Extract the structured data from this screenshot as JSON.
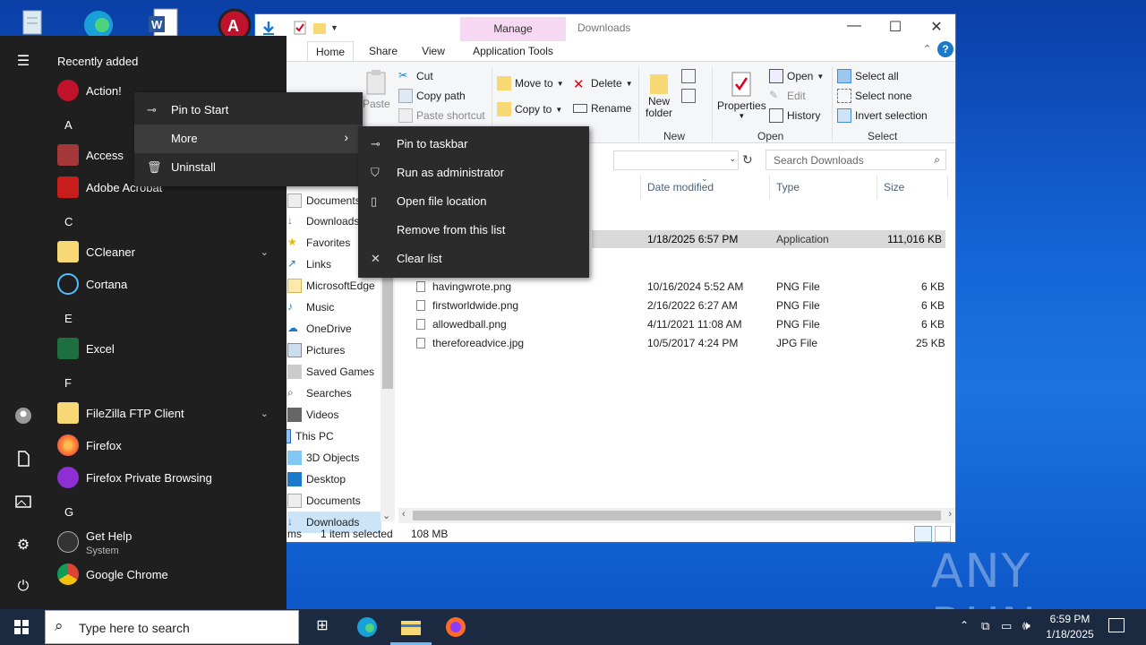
{
  "explorer": {
    "title": "Downloads",
    "manage_tab": "Manage",
    "tabs": [
      "Home",
      "Share",
      "View",
      "Application Tools"
    ],
    "ribbon": {
      "paste": "Paste",
      "cut": "Cut",
      "copy_path": "Copy path",
      "paste_shortcut": "Paste shortcut",
      "move_to": "Move to",
      "copy_to": "Copy to",
      "delete": "Delete",
      "rename": "Rename",
      "new_folder_1": "New",
      "new_folder_2": "folder",
      "new_group": "New",
      "properties": "Properties",
      "open": "Open",
      "edit": "Edit",
      "history": "History",
      "open_group": "Open",
      "select_all": "Select all",
      "select_none": "Select none",
      "invert_selection": "Invert selection",
      "select_group": "Select"
    },
    "search_placeholder": "Search Downloads",
    "columns": [
      "Date modified",
      "Type",
      "Size"
    ],
    "selected_row": {
      "date": "1/18/2025 6:57 PM",
      "type": "Application",
      "size": "111,016 KB"
    },
    "files": [
      {
        "name": "havingwrote.png",
        "date": "10/16/2024 5:52 AM",
        "type": "PNG File",
        "size": "6 KB"
      },
      {
        "name": "firstworldwide.png",
        "date": "2/16/2022 6:27 AM",
        "type": "PNG File",
        "size": "6 KB"
      },
      {
        "name": "allowedball.png",
        "date": "4/11/2021 11:08 AM",
        "type": "PNG File",
        "size": "6 KB"
      },
      {
        "name": "thereforeadvice.jpg",
        "date": "10/5/2017 4:24 PM",
        "type": "JPG File",
        "size": "25 KB"
      }
    ],
    "nav": [
      "Documents",
      "Downloads",
      "Favorites",
      "Links",
      "MicrosoftEdge",
      "Music",
      "OneDrive",
      "Pictures",
      "Saved Games",
      "Searches",
      "Videos",
      "This PC",
      "3D Objects",
      "Desktop",
      "Documents",
      "Downloads"
    ],
    "status": {
      "items_partial": "ms",
      "selected": "1 item selected",
      "size": "108 MB"
    }
  },
  "start_menu": {
    "header": "Recently added",
    "apps": [
      {
        "label": "Action!",
        "sub": ""
      },
      {
        "letter": "A"
      },
      {
        "label": "Access",
        "sub": ""
      },
      {
        "label": "Adobe Acrobat",
        "sub": ""
      },
      {
        "letter": "C"
      },
      {
        "label": "CCleaner",
        "sub": ""
      },
      {
        "label": "Cortana",
        "sub": ""
      },
      {
        "letter": "E"
      },
      {
        "label": "Excel",
        "sub": ""
      },
      {
        "letter": "F"
      },
      {
        "label": "FileZilla FTP Client",
        "sub": ""
      },
      {
        "label": "Firefox",
        "sub": ""
      },
      {
        "label": "Firefox Private Browsing",
        "sub": ""
      },
      {
        "letter": "G"
      },
      {
        "label": "Get Help",
        "sub": "System"
      },
      {
        "label": "Google Chrome",
        "sub": ""
      }
    ]
  },
  "context_menu": {
    "items": [
      "Pin to Start",
      "More",
      "Uninstall"
    ],
    "submenu": [
      "Pin to taskbar",
      "Run as administrator",
      "Open file location",
      "Remove from this list",
      "Clear list"
    ]
  },
  "taskbar": {
    "search_placeholder": "Type here to search",
    "time": "6:59 PM",
    "date": "1/18/2025"
  },
  "watermark": "ANY RUN"
}
